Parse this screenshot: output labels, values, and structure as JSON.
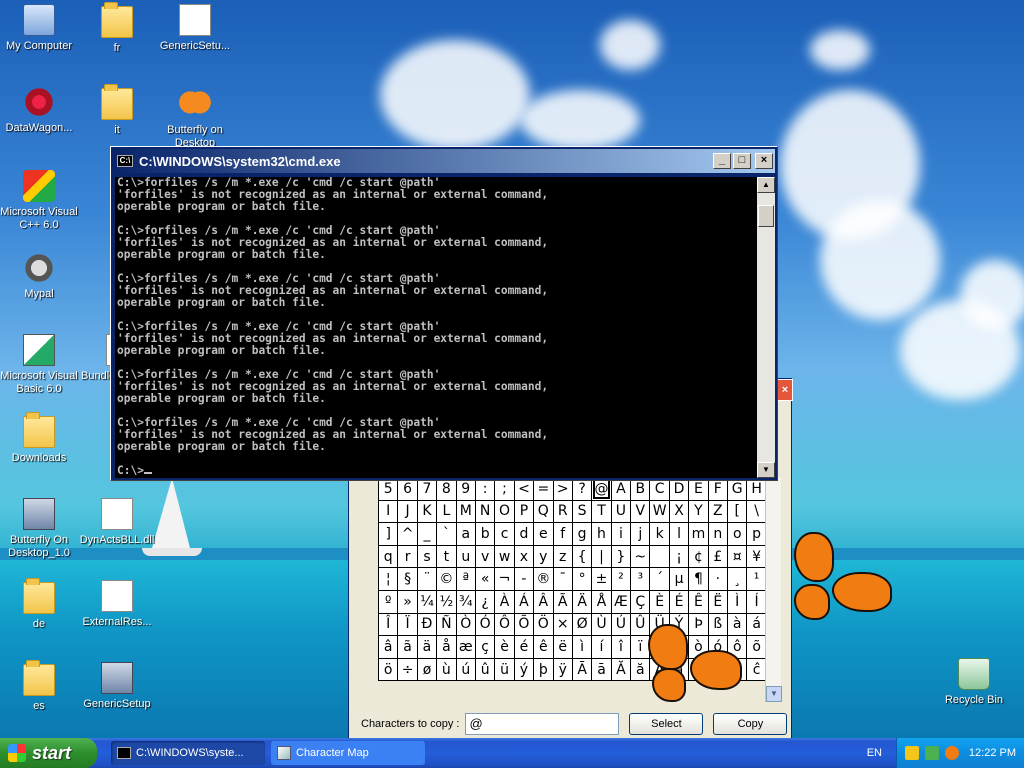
{
  "desktop": {
    "icons": [
      {
        "label": "My Computer"
      },
      {
        "label": "fr"
      },
      {
        "label": "GenericSetu..."
      },
      {
        "label": "DataWagon..."
      },
      {
        "label": "it"
      },
      {
        "label": "Butterfly on Desktop"
      },
      {
        "label": "Microsoft Visual C++ 6.0"
      },
      {
        "label": "Mypal"
      },
      {
        "label": "Microsoft Visual Basic 6.0"
      },
      {
        "label": "Bundle"
      },
      {
        "label": "Downloads"
      },
      {
        "label": "Butterfly On Desktop_1.0"
      },
      {
        "label": "DynActsBLL.dll"
      },
      {
        "label": "de"
      },
      {
        "label": "ExternalRes..."
      },
      {
        "label": "es"
      },
      {
        "label": "GenericSetup"
      },
      {
        "label": "Recycle Bin"
      }
    ]
  },
  "cmd_window": {
    "title": "C:\\WINDOWS\\system32\\cmd.exe",
    "minimize": "_",
    "maximize": "□",
    "close": "×",
    "output": "C:\\>forfiles /s /m *.exe /c 'cmd /c start @path'\n'forfiles' is not recognized as an internal or external command,\noperable program or batch file.\n\nC:\\>forfiles /s /m *.exe /c 'cmd /c start @path'\n'forfiles' is not recognized as an internal or external command,\noperable program or batch file.\n\nC:\\>forfiles /s /m *.exe /c 'cmd /c start @path'\n'forfiles' is not recognized as an internal or external command,\noperable program or batch file.\n\nC:\\>forfiles /s /m *.exe /c 'cmd /c start @path'\n'forfiles' is not recognized as an internal or external command,\noperable program or batch file.\n\nC:\\>forfiles /s /m *.exe /c 'cmd /c start @path'\n'forfiles' is not recognized as an internal or external command,\noperable program or batch file.\n\nC:\\>forfiles /s /m *.exe /c 'cmd /c start @path'\n'forfiles' is not recognized as an internal or external command,\noperable program or batch file.\n\n",
    "prompt": "C:\\>"
  },
  "charmap": {
    "close": "×",
    "rows": [
      [
        "5",
        "6",
        "7",
        "8",
        "9",
        ":",
        ";",
        "<",
        "=",
        ">",
        "?",
        "@",
        "A",
        "B",
        "C",
        "D",
        "E",
        "F",
        "G",
        "H"
      ],
      [
        "I",
        "J",
        "K",
        "L",
        "M",
        "N",
        "O",
        "P",
        "Q",
        "R",
        "S",
        "T",
        "U",
        "V",
        "W",
        "X",
        "Y",
        "Z",
        "[",
        "\\"
      ],
      [
        "]",
        "^",
        "_",
        "`",
        "a",
        "b",
        "c",
        "d",
        "e",
        "f",
        "g",
        "h",
        "i",
        "j",
        "k",
        "l",
        "m",
        "n",
        "o",
        "p"
      ],
      [
        "q",
        "r",
        "s",
        "t",
        "u",
        "v",
        "w",
        "x",
        "y",
        "z",
        "{",
        "|",
        "}",
        "~",
        " ",
        "¡",
        "¢",
        "£",
        "¤",
        "¥"
      ],
      [
        "¦",
        "§",
        "¨",
        "©",
        "ª",
        "«",
        "¬",
        "-",
        "®",
        "¯",
        "°",
        "±",
        "²",
        "³",
        "´",
        "µ",
        "¶",
        "·",
        "¸",
        "¹"
      ],
      [
        "º",
        "»",
        "¼",
        "½",
        "¾",
        "¿",
        "À",
        "Á",
        "Â",
        "Ã",
        "Ä",
        "Å",
        "Æ",
        "Ç",
        "È",
        "É",
        "Ê",
        "Ë",
        "Ì",
        "Í"
      ],
      [
        "Î",
        "Ï",
        "Ð",
        "Ñ",
        "Ò",
        "Ó",
        "Ô",
        "Õ",
        "Ö",
        "×",
        "Ø",
        "Ù",
        "Ú",
        "Û",
        "Ü",
        "Ý",
        "Þ",
        "ß",
        "à",
        "á"
      ],
      [
        "â",
        "ã",
        "ä",
        "å",
        "æ",
        "ç",
        "è",
        "é",
        "ê",
        "ë",
        "ì",
        "í",
        "î",
        "ï",
        "ð",
        "ñ",
        "ò",
        "ó",
        "ô",
        "õ"
      ],
      [
        "ö",
        "÷",
        "ø",
        "ù",
        "ú",
        "û",
        "ü",
        "ý",
        "þ",
        "ÿ",
        "Ā",
        "ā",
        "Ă",
        "ă",
        "Ą",
        "ą",
        "Ć",
        "ć",
        "Ĉ",
        "ĉ"
      ]
    ],
    "selected_char": "@",
    "chars_to_copy_label": "Characters to copy :",
    "chars_to_copy_value": "@",
    "select_label": "Select",
    "copy_label": "Copy"
  },
  "taskbar": {
    "start_label": "start",
    "tasks": [
      {
        "label": "C:\\WINDOWS\\syste..."
      },
      {
        "label": "Character Map"
      }
    ],
    "language": "EN",
    "clock": "12:22 PM"
  }
}
